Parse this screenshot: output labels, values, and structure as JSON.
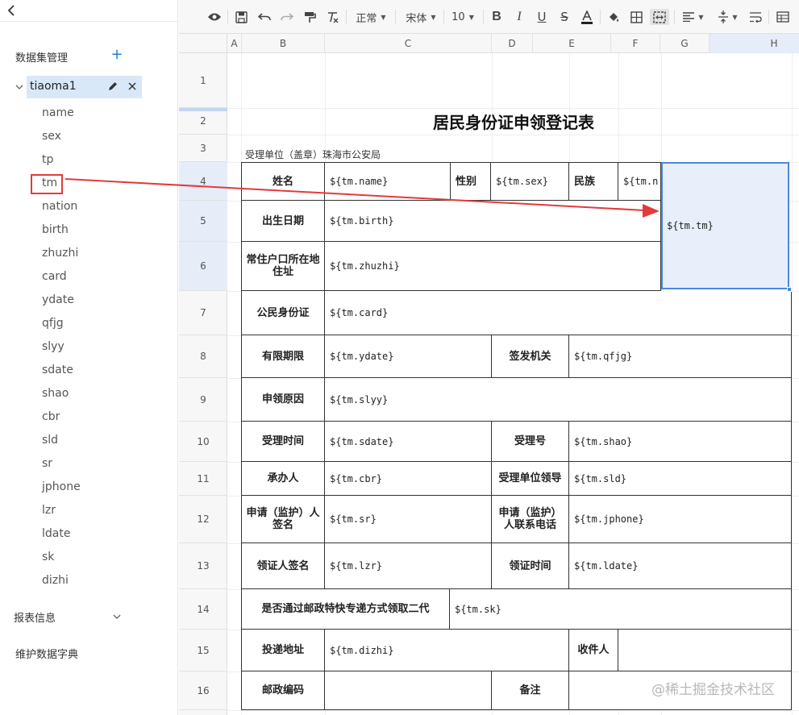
{
  "sidebar": {
    "dataset_mgmt_label": "数据集管理",
    "add_label": "+",
    "dataset_name": "tiaoma1",
    "fields": [
      "name",
      "sex",
      "tp",
      "tm",
      "nation",
      "birth",
      "zhuzhi",
      "card",
      "ydate",
      "qfjg",
      "slyy",
      "sdate",
      "shao",
      "cbr",
      "sld",
      "sr",
      "jphone",
      "lzr",
      "ldate",
      "sk",
      "dizhi"
    ],
    "report_info_label": "报表信息",
    "dict_label": "维护数据字典"
  },
  "toolbar": {
    "style_label": "正常",
    "font_label": "宋体",
    "size_label": "10"
  },
  "grid": {
    "columns": [
      "A",
      "B",
      "C",
      "D",
      "E",
      "F",
      "G",
      "H"
    ],
    "rows": [
      "1",
      "2",
      "3",
      "4",
      "5",
      "6",
      "7",
      "8",
      "9",
      "10",
      "11",
      "12",
      "13",
      "14",
      "15",
      "16"
    ],
    "selected_column": "H"
  },
  "sheet": {
    "title": "居民身份证申领登记表",
    "unit": "受理单位（盖章）珠海市公安局",
    "labels": {
      "name": "姓名",
      "sex": "性别",
      "nation": "民族",
      "birth": "出生日期",
      "address": "常住户口所在地住址",
      "card": "公民身份证",
      "period": "有限期限",
      "issuer": "签发机关",
      "reason": "申领原因",
      "accept_time": "受理时间",
      "accept_no": "受理号",
      "handler": "承办人",
      "leader": "受理单位领导",
      "signer": "申请（监护）人签名",
      "contact": "申请（监护）人联系电话",
      "receiver_sign": "领证人签名",
      "receive_time": "领证时间",
      "post_q": "是否通过邮政特快专递方式领取二代",
      "post_addr": "投递地址",
      "recipient": "收件人",
      "postcode": "邮政编码",
      "remark": "备注"
    },
    "values": {
      "name": "${tm.name}",
      "sex": "${tm.sex}",
      "nation": "${tm.n",
      "birth": "${tm.birth}",
      "address": "${tm.zhuzhi}",
      "card": "${tm.card}",
      "period": "${tm.ydate}",
      "issuer": "${tm.qfjg}",
      "reason": "${tm.slyy}",
      "accept_time": "${tm.sdate}",
      "accept_no": "${tm.shao}",
      "handler": "${tm.cbr}",
      "leader": "${tm.sld}",
      "signer": "${tm.sr}",
      "contact": "${tm.jphone}",
      "receiver_sign": "${tm.lzr}",
      "receive_time": "${tm.ldate}",
      "post_q": "${tm.sk}",
      "post_addr": "${tm.dizhi}",
      "barcode": "${tm.tm}"
    }
  },
  "watermark": "@稀土掘金技术社区",
  "colors": {
    "annotation_red": "#e23b3b",
    "selection_blue": "#4a89dc",
    "accent_blue": "#1f7ed9"
  }
}
